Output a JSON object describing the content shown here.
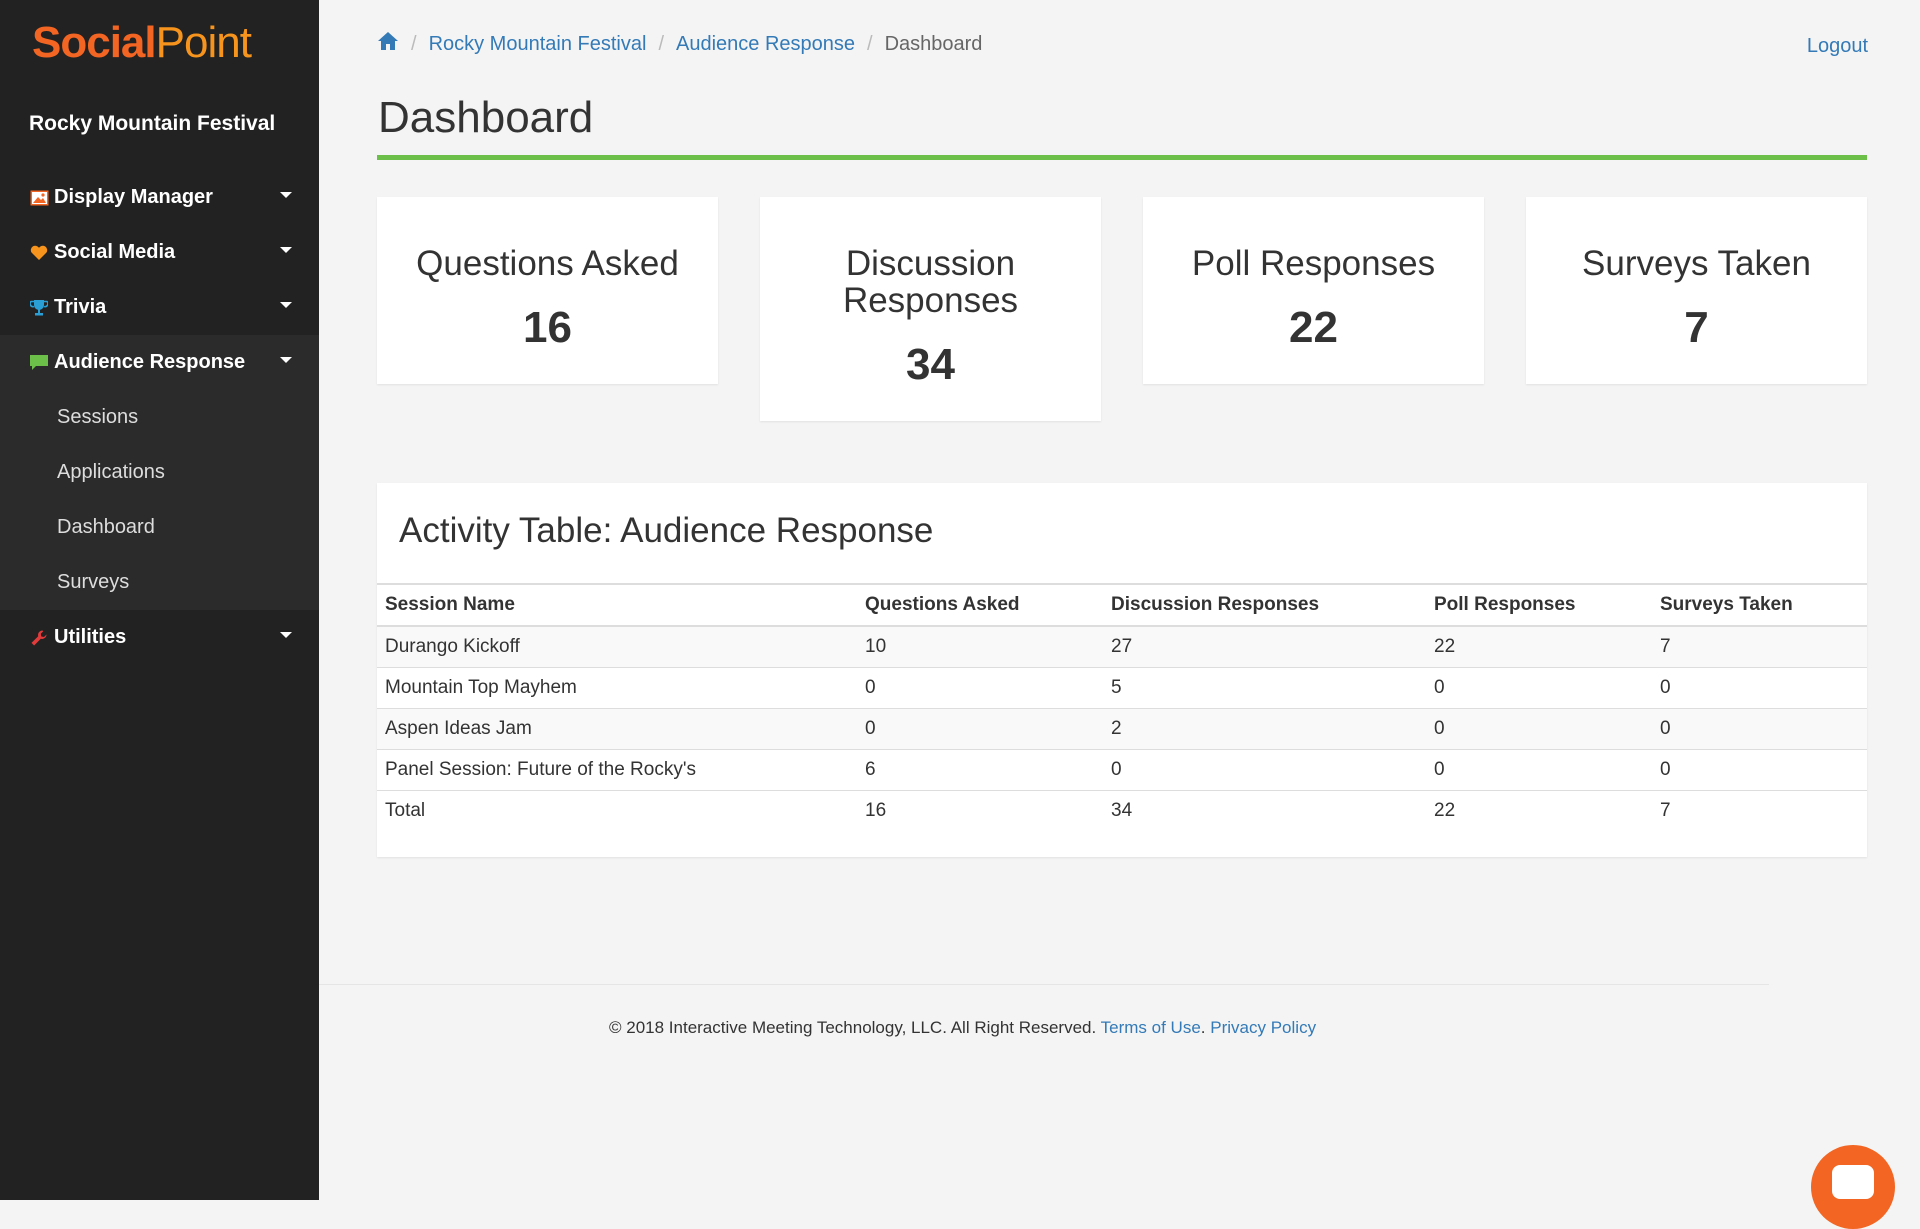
{
  "brand": {
    "part1": "Social",
    "part2": "Point"
  },
  "event_name": "Rocky Mountain Festival",
  "nav": {
    "display_manager": "Display Manager",
    "social_media": "Social Media",
    "trivia": "Trivia",
    "audience_response": "Audience Response",
    "sub": [
      "Sessions",
      "Applications",
      "Dashboard",
      "Surveys"
    ],
    "utilities": "Utilities"
  },
  "breadcrumb": {
    "home_icon": "home-icon",
    "items": [
      "Rocky Mountain Festival",
      "Audience Response",
      "Dashboard"
    ],
    "separator": "/"
  },
  "logout": "Logout",
  "page_title": "Dashboard",
  "stats": [
    {
      "label": "Questions Asked",
      "value": "16"
    },
    {
      "label": "Discussion Responses",
      "value": "34"
    },
    {
      "label": "Poll Responses",
      "value": "22"
    },
    {
      "label": "Surveys Taken",
      "value": "7"
    }
  ],
  "activity": {
    "title": "Activity Table: Audience Response",
    "headers": [
      "Session Name",
      "Questions Asked",
      "Discussion Responses",
      "Poll Responses",
      "Surveys Taken"
    ],
    "rows": [
      [
        "Durango Kickoff",
        "10",
        "27",
        "22",
        "7"
      ],
      [
        "Mountain Top Mayhem",
        "0",
        "5",
        "0",
        "0"
      ],
      [
        "Aspen Ideas Jam",
        "0",
        "2",
        "0",
        "0"
      ],
      [
        "Panel Session: Future of the Rocky's",
        "6",
        "0",
        "0",
        "0"
      ],
      [
        "Total",
        "16",
        "34",
        "22",
        "7"
      ]
    ]
  },
  "footer": {
    "copyright": "© 2018 Interactive Meeting Technology, LLC. All Right Reserved.",
    "terms": "Terms of Use",
    "dot": ".",
    "privacy": "Privacy Policy"
  },
  "colors": {
    "accent_green": "#6cc04a",
    "link_blue": "#337ab7",
    "brand_orange": "#f26522",
    "sidebar_bg": "#222222"
  }
}
